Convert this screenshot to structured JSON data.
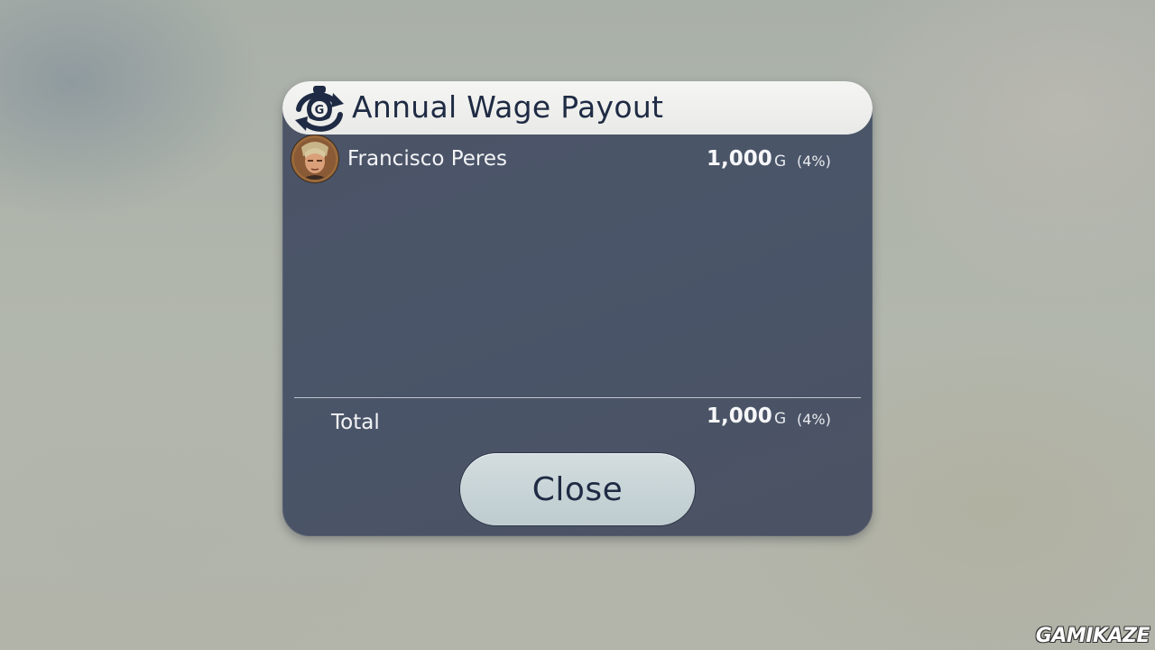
{
  "dialog": {
    "title": "Annual Wage Payout",
    "header_icon": "gold-money-bag-icon",
    "employees": [
      {
        "name": "Francisco Peres",
        "amount": "1,000",
        "currency": "G",
        "percent": "(4%)"
      }
    ],
    "total": {
      "label": "Total",
      "amount": "1,000",
      "currency": "G",
      "percent": "(4%)"
    },
    "close_label": "Close"
  },
  "watermark": "GAMIKAZE",
  "colors": {
    "panel": "#4a5569",
    "header": "#eeefec",
    "title_text": "#1f2b44",
    "button": "#c9d4d7"
  }
}
